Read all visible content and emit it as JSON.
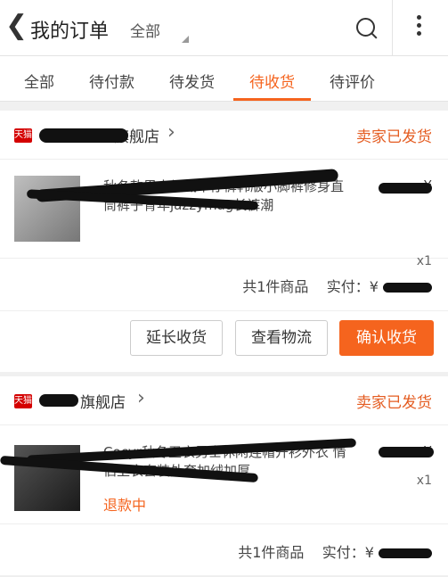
{
  "header": {
    "back_icon": "chevron-left-icon",
    "title": "我的订单",
    "filter": "全部",
    "search_icon": "search-icon",
    "more_icon": "more-vertical-icon"
  },
  "tabs": [
    {
      "label": "全部"
    },
    {
      "label": "待付款"
    },
    {
      "label": "待发货"
    },
    {
      "label": "待收货",
      "active": true
    },
    {
      "label": "待评价"
    }
  ],
  "orders": [
    {
      "shop_badge": "天猫",
      "shop_name": "旗舰店",
      "status": "卖家已发货",
      "item_title": "秋冬款男士加绒牛仔裤韩版小脚裤修身直筒裤子青年jazzymag长裤潮",
      "price": "¥",
      "qty": "x1",
      "summary_count": "共1件商品",
      "summary_paid": "实付：¥",
      "buttons": [
        "延长收货",
        "查看物流",
        "确认收货"
      ]
    },
    {
      "shop_badge": "天猫",
      "shop_name": "旗舰店",
      "status": "卖家已发货",
      "item_title": "Cocyr秋冬卫衣男士休闲连帽开衫外衣 情侣卫衣套装外套加绒加厚",
      "price": "¥",
      "qty": "x1",
      "refund": "退款中",
      "summary_count": "共1件商品",
      "summary_paid": "实付：¥"
    }
  ],
  "colors": {
    "accent": "#f5641e",
    "tmall": "#d40000"
  }
}
